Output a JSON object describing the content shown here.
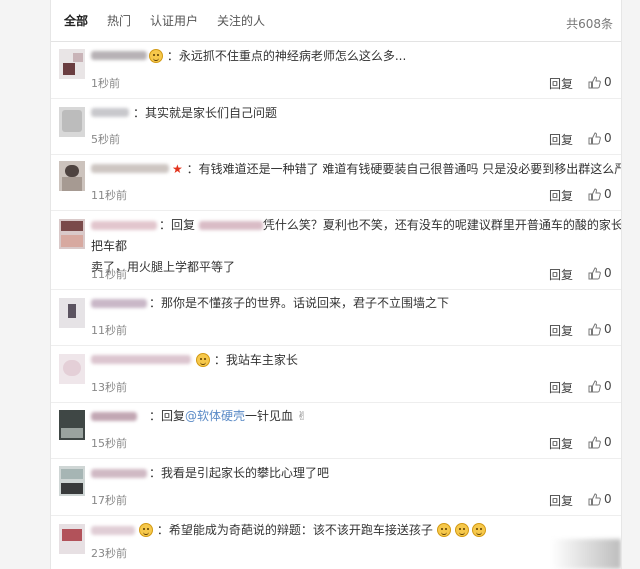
{
  "tabs": [
    "全部",
    "热门",
    "认证用户",
    "关注的人"
  ],
  "total": "共608条",
  "reply_label": "回复",
  "like_count": "0",
  "comments": [
    {
      "name_suffix": "：",
      "text": "永远抓不住重点的神经病老师怎么这么多...",
      "time": "1秒前"
    },
    {
      "name_suffix": "：",
      "text": "其实就是家长们自己问题",
      "time": "5秒前"
    },
    {
      "name_suffix": "：",
      "text": "有钱难道还是一种错了 难道有钱硬要装自己很普通吗 只是没必要到移出群这么严重吧",
      "time": "11秒前"
    },
    {
      "name_suffix": "：",
      "text_pre": "回复",
      "text_mid": "凭什么笑？夏利也不笑，还有没车的呢建议群里开普通车的酸的家长把车都",
      "text_line2": "卖了，用火腿上学都平等了",
      "time": "11秒前"
    },
    {
      "name_suffix": "：",
      "text": "那你是不懂孩子的世界。话说回来，君子不立围墙之下",
      "time": "11秒前"
    },
    {
      "name_suffix": "：",
      "text": "我站车主家长",
      "time": "13秒前"
    },
    {
      "name_suffix": "：",
      "text_pre": "回复",
      "mention": "@软体硬壳",
      "text_post": "一针见血",
      "time": "15秒前"
    },
    {
      "name_suffix": "：",
      "text": "我看是引起家长的攀比心理了吧",
      "time": "17秒前"
    },
    {
      "name_suffix": "：",
      "text": "希望能成为奇葩说的辩题：该不该开跑车接送孩子",
      "time": "23秒前"
    }
  ]
}
